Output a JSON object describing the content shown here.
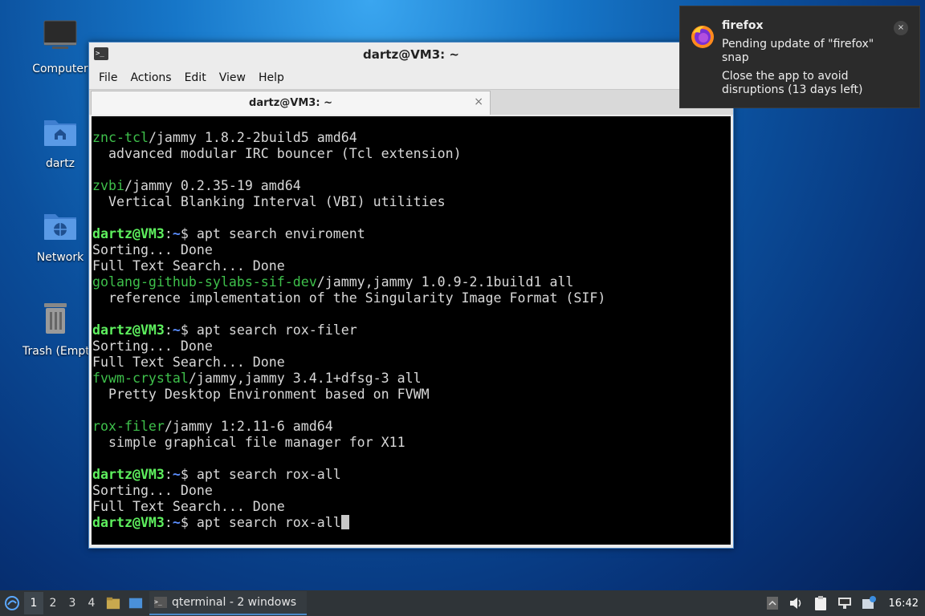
{
  "desktop": {
    "icons": [
      {
        "label": "Computer",
        "icon": "computer-icon"
      },
      {
        "label": "dartz",
        "icon": "home-folder-icon"
      },
      {
        "label": "Network",
        "icon": "network-folder-icon"
      },
      {
        "label": "Trash (Empty)",
        "icon": "trash-icon"
      }
    ]
  },
  "window": {
    "title": "dartz@VM3: ~",
    "menu": [
      "File",
      "Actions",
      "Edit",
      "View",
      "Help"
    ],
    "tab_label": "dartz@VM3: ~",
    "tab_close": "×"
  },
  "terminal": {
    "prompt_user": "dartz@VM3",
    "prompt_path": "~",
    "lines": [
      {
        "kind": "pkg",
        "name": "znc-tcl",
        "rest": "/jammy 1.8.2-2build5 amd64"
      },
      {
        "kind": "text",
        "text": "  advanced modular IRC bouncer (Tcl extension)"
      },
      {
        "kind": "blank"
      },
      {
        "kind": "pkg",
        "name": "zvbi",
        "rest": "/jammy 0.2.35-19 amd64"
      },
      {
        "kind": "text",
        "text": "  Vertical Blanking Interval (VBI) utilities"
      },
      {
        "kind": "blank"
      },
      {
        "kind": "cmd",
        "cmd": "apt search enviroment"
      },
      {
        "kind": "text",
        "text": "Sorting... Done"
      },
      {
        "kind": "text",
        "text": "Full Text Search... Done"
      },
      {
        "kind": "pkg",
        "name": "golang-github-sylabs-sif-dev",
        "rest": "/jammy,jammy 1.0.9-2.1build1 all"
      },
      {
        "kind": "text",
        "text": "  reference implementation of the Singularity Image Format (SIF)"
      },
      {
        "kind": "blank"
      },
      {
        "kind": "cmd",
        "cmd": "apt search rox-filer"
      },
      {
        "kind": "text",
        "text": "Sorting... Done"
      },
      {
        "kind": "text",
        "text": "Full Text Search... Done"
      },
      {
        "kind": "pkg",
        "name": "fvwm-crystal",
        "rest": "/jammy,jammy 3.4.1+dfsg-3 all"
      },
      {
        "kind": "text",
        "text": "  Pretty Desktop Environment based on FVWM"
      },
      {
        "kind": "blank"
      },
      {
        "kind": "pkg",
        "name": "rox-filer",
        "rest": "/jammy 1:2.11-6 amd64"
      },
      {
        "kind": "text",
        "text": "  simple graphical file manager for X11"
      },
      {
        "kind": "blank"
      },
      {
        "kind": "cmd",
        "cmd": "apt search rox-all"
      },
      {
        "kind": "text",
        "text": "Sorting... Done"
      },
      {
        "kind": "text",
        "text": "Full Text Search... Done"
      },
      {
        "kind": "cmd",
        "cmd": "apt search rox-all",
        "cursor": true
      }
    ]
  },
  "notification": {
    "app": "firefox",
    "icon": "firefox-icon",
    "close": "×",
    "message": "Pending update of \"firefox\"\nsnap",
    "detail": "Close the app to avoid\ndisruptions (13 days left)"
  },
  "taskbar": {
    "workspaces": [
      "1",
      "2",
      "3",
      "4"
    ],
    "active_workspace": "1",
    "task_label": "qterminal - 2 windows",
    "clock": "16:42"
  },
  "colors": {
    "package_green": "#3ec04b",
    "prompt_user_green": "#5ef05e",
    "prompt_path_blue": "#5c8fff",
    "window_border": "#4a86c5"
  }
}
